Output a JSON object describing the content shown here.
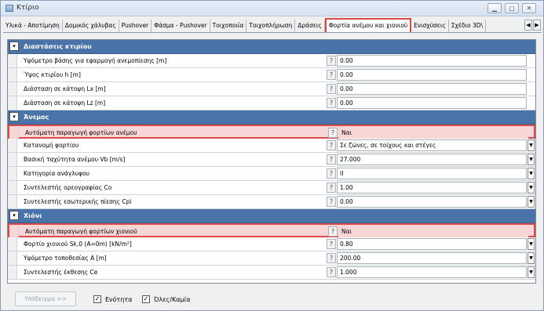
{
  "window": {
    "title": "Κτίριο"
  },
  "tabs": [
    "Υλικά - Αποτίμηση",
    "Δομικός χάλυβας",
    "Pushover",
    "Φάσμα - Pushover",
    "Τοιχοποιία",
    "Τοιχοπλήρωση",
    "Δράσεις",
    "Φορτία ανέμου και χιονιού",
    "Ενισχύσεις",
    "Σχέδιο 3D\\"
  ],
  "active_tab_index": 7,
  "sections": {
    "dimensions": {
      "title": "Διαστάσεις κτιρίου",
      "rows": [
        {
          "label": "Υψόμετρο βάσης για εφαρμογή ανεμοπίεσης [m]",
          "value": "0.00"
        },
        {
          "label": "Ύψος κτιρίου h [m]",
          "value": "0.00"
        },
        {
          "label": "Διάσταση σε κάτοψη Lx [m]",
          "value": "0.00"
        },
        {
          "label": "Διάσταση σε κάτοψη Lz [m]",
          "value": "0.00"
        }
      ]
    },
    "wind": {
      "title": "Άνεμος",
      "rows": [
        {
          "label": "Αυτόματη παραγωγή φορτίων ανέμου",
          "value": "Ναι"
        },
        {
          "label": "Κατανομή φορτίου",
          "value": "Σε ζώνες, σε τοίχους και στέγες"
        },
        {
          "label": "Βασική ταχύτητα ανέμου Vb [m/s]",
          "value": "27.000"
        },
        {
          "label": "Κατηγορία ανάγλυφου",
          "value": "II"
        },
        {
          "label": "Συντελεστής ορεογραφίας Co",
          "value": "1.00"
        },
        {
          "label": "Συντελεστής εσωτερικής πίεσης Cpi",
          "value": "0.00"
        }
      ]
    },
    "snow": {
      "title": "Χιόνι",
      "rows": [
        {
          "label": "Αυτόματη παραγωγή φορτίων χιονιού",
          "value": "Ναι"
        },
        {
          "label": "Φορτίο χιονιού Sk,0 (A=0m) [kN/m²]",
          "value": "0.80"
        },
        {
          "label": "Υψόμετρο τοποθεσίας A [m]",
          "value": "200.00"
        },
        {
          "label": "Συντελεστής έκθεσης Ce",
          "value": "1.000"
        }
      ]
    }
  },
  "help_mark": "?",
  "toggle_mark": "▾",
  "bottom": {
    "next_button": "Υπόδειγμα >>",
    "check1": "Ενότητα",
    "check2": "Όλες/Καμία"
  }
}
